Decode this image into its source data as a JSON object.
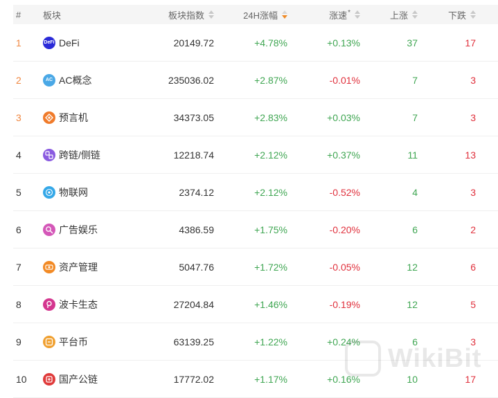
{
  "columns": {
    "rank": "#",
    "sector": "板块",
    "index": "板块指数",
    "change_24h": "24H涨幅",
    "speed": "涨速",
    "speed_sup": "*",
    "up": "上涨",
    "down": "下跌"
  },
  "sort": {
    "index": "none",
    "change_24h": "descending",
    "speed": "none",
    "up": "none",
    "down": "none"
  },
  "rows": [
    {
      "rank": "1",
      "name": "DeFi",
      "icon": "defi-icon",
      "icon_label": "DeFi",
      "icon_color": "#2b2bd8",
      "index": "20149.72",
      "change_24h": "+4.78%",
      "speed": "+0.13%",
      "up": "37",
      "down": "17"
    },
    {
      "rank": "2",
      "name": "AC概念",
      "icon": "ac-icon",
      "icon_label": "AC",
      "icon_color": "#4aa8e6",
      "index": "235036.02",
      "change_24h": "+2.87%",
      "speed": "-0.01%",
      "up": "7",
      "down": "3"
    },
    {
      "rank": "3",
      "name": "预言机",
      "icon": "oracle-icon",
      "icon_label": "",
      "icon_color": "#f07b2b",
      "index": "34373.05",
      "change_24h": "+2.83%",
      "speed": "+0.03%",
      "up": "7",
      "down": "3"
    },
    {
      "rank": "4",
      "name": "跨链/侧链",
      "icon": "cross-chain-icon",
      "icon_label": "",
      "icon_color": "#8a5be0",
      "index": "12218.74",
      "change_24h": "+2.12%",
      "speed": "+0.37%",
      "up": "11",
      "down": "13"
    },
    {
      "rank": "5",
      "name": "物联网",
      "icon": "iot-icon",
      "icon_label": "",
      "icon_color": "#35a8e8",
      "index": "2374.12",
      "change_24h": "+2.12%",
      "speed": "-0.52%",
      "up": "4",
      "down": "3"
    },
    {
      "rank": "6",
      "name": "广告娱乐",
      "icon": "entertainment-icon",
      "icon_label": "",
      "icon_color": "#d457b8",
      "index": "4386.59",
      "change_24h": "+1.75%",
      "speed": "-0.20%",
      "up": "6",
      "down": "2"
    },
    {
      "rank": "7",
      "name": "资产管理",
      "icon": "asset-management-icon",
      "icon_label": "",
      "icon_color": "#f28a25",
      "index": "5047.76",
      "change_24h": "+1.72%",
      "speed": "-0.05%",
      "up": "12",
      "down": "6"
    },
    {
      "rank": "8",
      "name": "波卡生态",
      "icon": "polkadot-icon",
      "icon_label": "",
      "icon_color": "#d4368f",
      "index": "27204.84",
      "change_24h": "+1.46%",
      "speed": "-0.19%",
      "up": "12",
      "down": "5"
    },
    {
      "rank": "9",
      "name": "平台币",
      "icon": "platform-coin-icon",
      "icon_label": "",
      "icon_color": "#f0a030",
      "index": "63139.25",
      "change_24h": "+1.22%",
      "speed": "+0.24%",
      "up": "6",
      "down": "3"
    },
    {
      "rank": "10",
      "name": "国产公链",
      "icon": "domestic-chain-icon",
      "icon_label": "",
      "icon_color": "#e03b3b",
      "index": "17772.02",
      "change_24h": "+1.17%",
      "speed": "+0.16%",
      "up": "10",
      "down": "17"
    }
  ],
  "watermark": {
    "text": "WikiBit"
  }
}
